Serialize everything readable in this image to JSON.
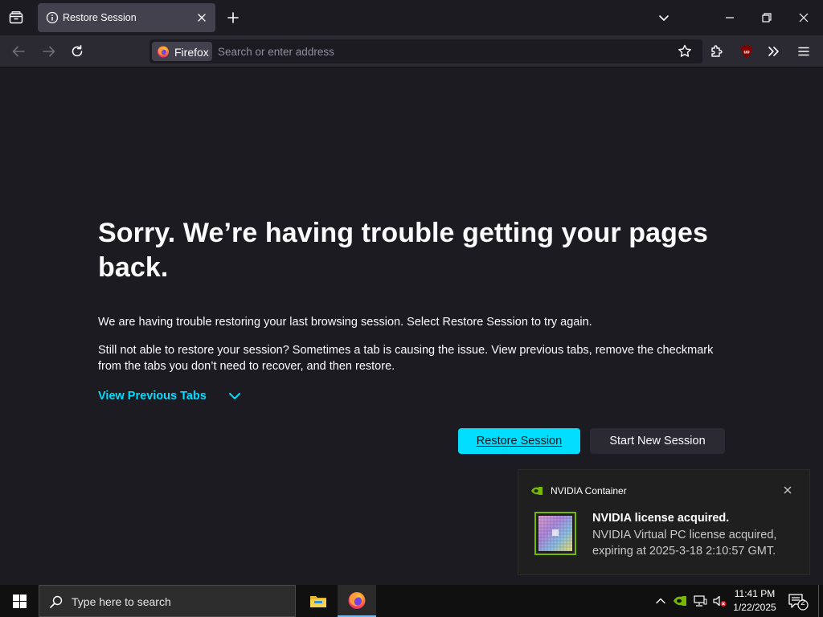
{
  "tab": {
    "title": "Restore Session"
  },
  "urlbar": {
    "identity_label": "Firefox",
    "placeholder": "Search or enter address"
  },
  "content": {
    "heading": "Sorry. We’re having trouble getting your pages back.",
    "para1": "We are having trouble restoring your last browsing session. Select Restore Session to try again.",
    "para2": "Still not able to restore your session? Sometimes a tab is causing the issue. View previous tabs, remove the checkmark from the tabs you don’t need to recover, and then restore.",
    "view_previous_tabs": "View Previous Tabs",
    "restore_button": "Restore Session",
    "new_session_button": "Start New Session"
  },
  "notification": {
    "app_name": "NVIDIA Container",
    "title": "NVIDIA license acquired.",
    "body": "NVIDIA Virtual PC license acquired, expiring at 2025-3-18 2:10:57 GMT."
  },
  "taskbar": {
    "search_placeholder": "Type here to search",
    "time": "11:41 PM",
    "date": "1/22/2025",
    "notification_count": "2"
  },
  "colors": {
    "accent": "#00ddff",
    "page_bg": "#1c1b22",
    "toolbar_bg": "#2b2a33",
    "nvidia_green": "#76b900"
  }
}
